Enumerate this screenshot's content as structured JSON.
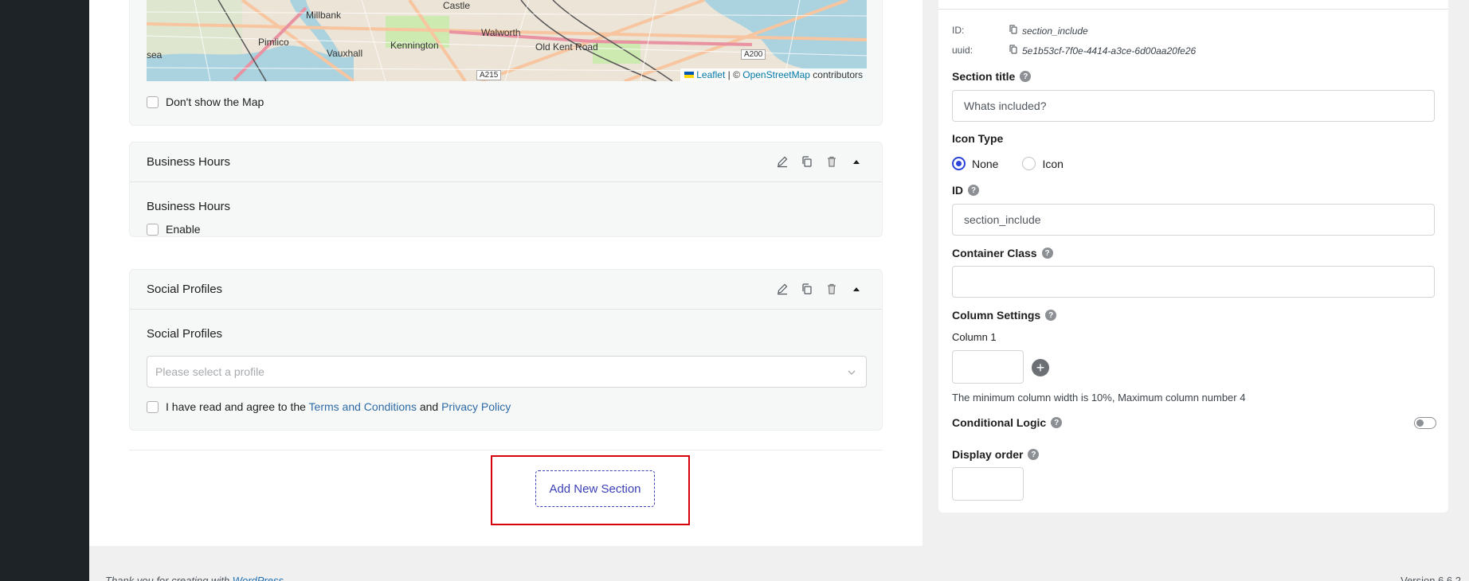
{
  "map": {
    "labels": [
      "Castle",
      "Millbank",
      "Pimlico",
      "Kennington",
      "Walworth",
      "Old Kent Road",
      "Vauxhall",
      "sea"
    ],
    "roads": [
      "A215",
      "A200"
    ],
    "attribution": {
      "leaflet": "Leaflet",
      "separator": " | © ",
      "osm": "OpenStreetMap",
      "suffix": " contributors"
    },
    "hide_map_label": "Don't show the Map"
  },
  "business_hours": {
    "header": "Business Hours",
    "field_title": "Business Hours",
    "enable_label": "Enable"
  },
  "social_profiles": {
    "header": "Social Profiles",
    "field_title": "Social Profiles",
    "select_placeholder": "Please select a profile",
    "agree_prefix": "I have read and agree to the ",
    "terms_link": "Terms and Conditions",
    "agree_and": " and ",
    "privacy_link": "Privacy Policy"
  },
  "add_section_label": "Add New Section",
  "settings": {
    "id_label": "ID:",
    "id_value": "section_include",
    "uuid_label": "uuid:",
    "uuid_value": "5e1b53cf-7f0e-4414-a3ce-6d00aa20fe26",
    "section_title_label": "Section title",
    "section_title_value": "Whats included?",
    "icon_type_label": "Icon Type",
    "icon_options": [
      "None",
      "Icon"
    ],
    "icon_selected": "None",
    "id_field_label": "ID",
    "id_field_value": "section_include",
    "container_class_label": "Container Class",
    "container_class_value": "",
    "column_settings_label": "Column Settings",
    "column_1_label": "Column 1",
    "column_note": "The minimum column width is 10%, Maximum column number 4",
    "conditional_logic_label": "Conditional Logic",
    "conditional_logic_on": false,
    "display_order_label": "Display order"
  },
  "footer": {
    "thanks_prefix": "Thank you for creating with ",
    "wordpress": "WordPress",
    "version": "Version 6.6.2"
  },
  "colors": {
    "accent": "#2b43d8",
    "highlight_box": "#d8000c",
    "link": "#2e6ba5"
  }
}
